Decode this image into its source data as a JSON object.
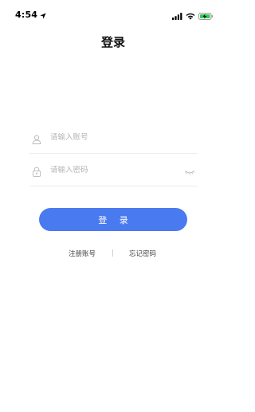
{
  "status_bar": {
    "time": "4:54"
  },
  "page": {
    "title": "登录"
  },
  "form": {
    "account_placeholder": "请输入账号",
    "account_value": "",
    "password_placeholder": "请输入密码",
    "password_value": ""
  },
  "actions": {
    "login_label": "登 录",
    "register_label": "注册账号",
    "forgot_label": "忘记密码"
  },
  "colors": {
    "accent": "#4a7af0",
    "battery_fill": "#34c759"
  },
  "icons": {
    "status": [
      "location-arrow-icon",
      "cellular-signal-icon",
      "wifi-icon",
      "battery-charging-icon"
    ],
    "form": [
      "user-icon",
      "lock-icon",
      "eye-closed-icon"
    ]
  }
}
